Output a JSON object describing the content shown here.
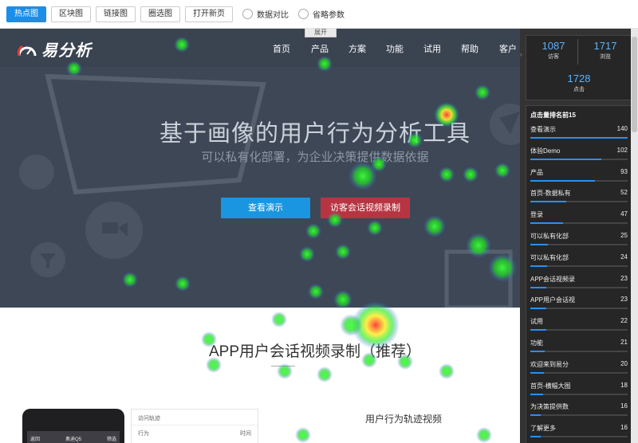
{
  "toolbar": {
    "buttons": [
      {
        "label": "热点图",
        "active": true
      },
      {
        "label": "区块图",
        "active": false
      },
      {
        "label": "链接图",
        "active": false
      },
      {
        "label": "圈选图",
        "active": false
      },
      {
        "label": "打开新页",
        "active": false
      }
    ],
    "radios": [
      {
        "label": "数据对比"
      },
      {
        "label": "省略参数"
      }
    ],
    "expand_label": "展开"
  },
  "site": {
    "logo_text": "易分析",
    "nav": [
      "首页",
      "产品",
      "方案",
      "功能",
      "试用",
      "帮助",
      "客户"
    ],
    "hero_title": "基于画像的用户行为分析工具",
    "hero_subtitle": "可以私有化部署，为企业决策提供数据依据",
    "btn_demo": "查看演示",
    "btn_video": "访客会话视频录制",
    "section_title": "APP用户会话视频录制（推荐）",
    "phone_back": "返回",
    "phone_title": "奥迪Q5",
    "phone_filter": "筛选",
    "track_header": "访问轨迹",
    "track_col1": "行为",
    "track_col2": "时间",
    "video_label": "用户行为轨迹视频"
  },
  "panel": {
    "visitors": {
      "value": "1087",
      "label": "访客"
    },
    "views": {
      "value": "1717",
      "label": "浏览"
    },
    "clicks": {
      "value": "1728",
      "label": "点击"
    },
    "rank_title": "点击量排名前15",
    "ranking": [
      {
        "label": "查看演示",
        "value": "140",
        "ratio": 1.0
      },
      {
        "label": "体验Demo",
        "value": "102",
        "ratio": 0.73
      },
      {
        "label": "产品",
        "value": "93",
        "ratio": 0.66
      },
      {
        "label": "首页-数据私有",
        "value": "52",
        "ratio": 0.37
      },
      {
        "label": "登录",
        "value": "47",
        "ratio": 0.34
      },
      {
        "label": "可以私有化部",
        "value": "25",
        "ratio": 0.18
      },
      {
        "label": "可以私有化部",
        "value": "24",
        "ratio": 0.17
      },
      {
        "label": "APP会话视频录",
        "value": "23",
        "ratio": 0.16
      },
      {
        "label": "APP用户会话视",
        "value": "23",
        "ratio": 0.16
      },
      {
        "label": "试用",
        "value": "22",
        "ratio": 0.16
      },
      {
        "label": "功能",
        "value": "21",
        "ratio": 0.15
      },
      {
        "label": "欢迎来到易分",
        "value": "20",
        "ratio": 0.14
      },
      {
        "label": "首页-横幅大图",
        "value": "18",
        "ratio": 0.13
      },
      {
        "label": "为决策提供数",
        "value": "16",
        "ratio": 0.11
      },
      {
        "label": "了解更多",
        "value": "16",
        "ratio": 0.11
      }
    ]
  },
  "colors": {
    "accent": "#1a8ee8",
    "hero_bg": "#3d4756",
    "video_btn": "#b73542",
    "panel_bg": "#333333"
  }
}
